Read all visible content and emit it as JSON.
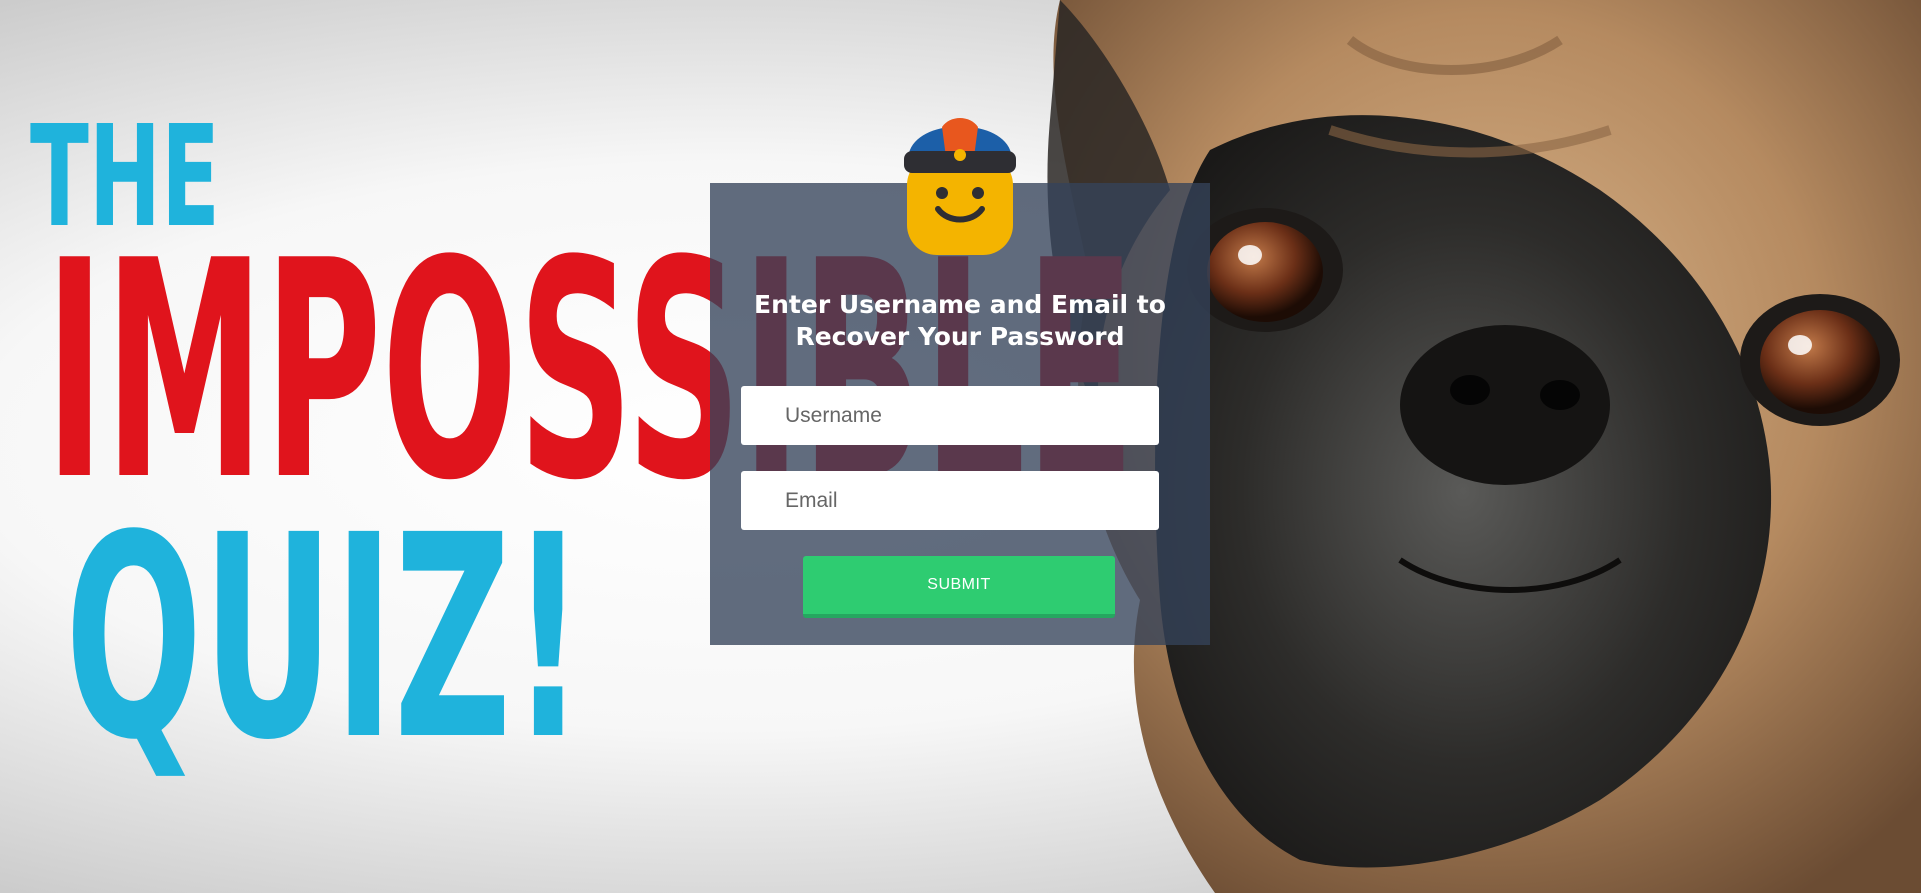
{
  "background": {
    "logo": {
      "line1": "THE",
      "line2": "IMPOSSIBLE",
      "line3": "QUIZ!",
      "colors": {
        "cyan": "#1fb3dc",
        "red": "#e0141c"
      }
    },
    "photo": "pug-face-image"
  },
  "recover": {
    "title": "Enter Username and Email to Recover Your Password",
    "username_placeholder": "Username",
    "email_placeholder": "Email",
    "submit_label": "SUBMIT",
    "mascot_icon": "hat-smiley-icon",
    "colors": {
      "panel": "#34435a",
      "submit": "#2ecc71"
    }
  }
}
